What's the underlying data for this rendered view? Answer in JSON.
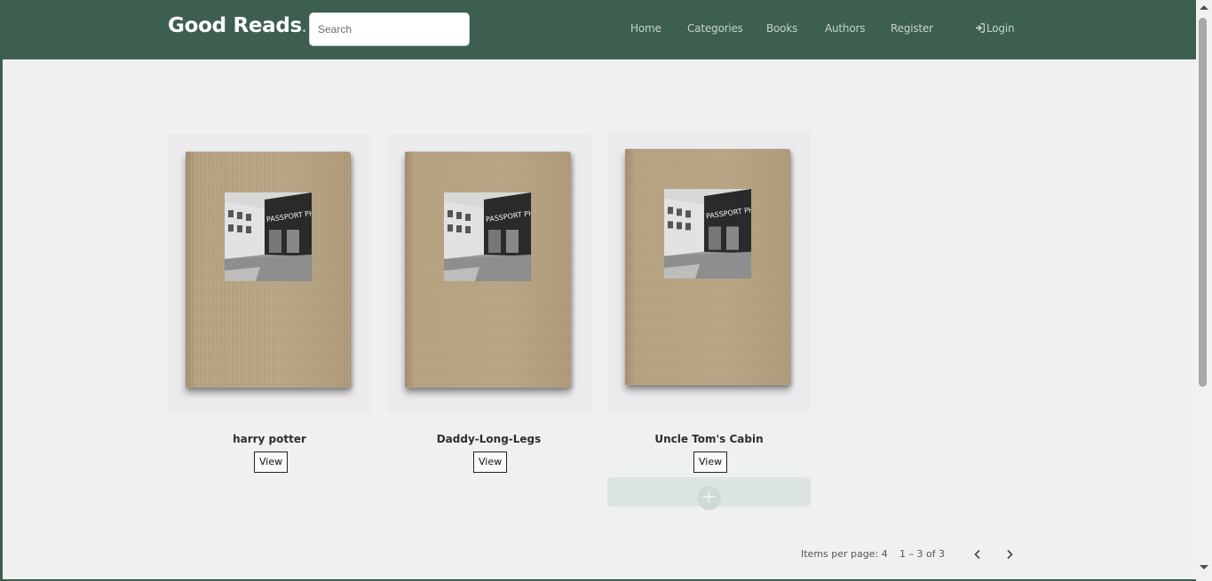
{
  "header": {
    "brand": "Good Reads",
    "brand_dot": ".",
    "search_placeholder": "Search",
    "nav": {
      "home": "Home",
      "categories": "Categories",
      "books": "Books",
      "authors": "Authors",
      "register": "Register",
      "login": "Login"
    }
  },
  "books": [
    {
      "title": "harry potter",
      "view_label": "View",
      "cover_sign": "PASSPORT PHOTOS"
    },
    {
      "title": "Daddy-Long-Legs",
      "view_label": "View",
      "cover_sign": "PASSPORT PHOTOS"
    },
    {
      "title": "Uncle Tom's Cabin",
      "view_label": "View",
      "cover_sign": "PASSPORT PHOTOS"
    }
  ],
  "add_button": {
    "icon": "plus-icon",
    "symbol": "+"
  },
  "paginator": {
    "items_per_page": "Items per page: 4",
    "range": "1 – 3 of 3",
    "prev_icon": "chevron-left-icon",
    "next_icon": "chevron-right-icon"
  },
  "colors": {
    "navbar": "#3d5f50",
    "page_bg": "#eff1f1",
    "brand_dot": "#8fd1a6"
  }
}
